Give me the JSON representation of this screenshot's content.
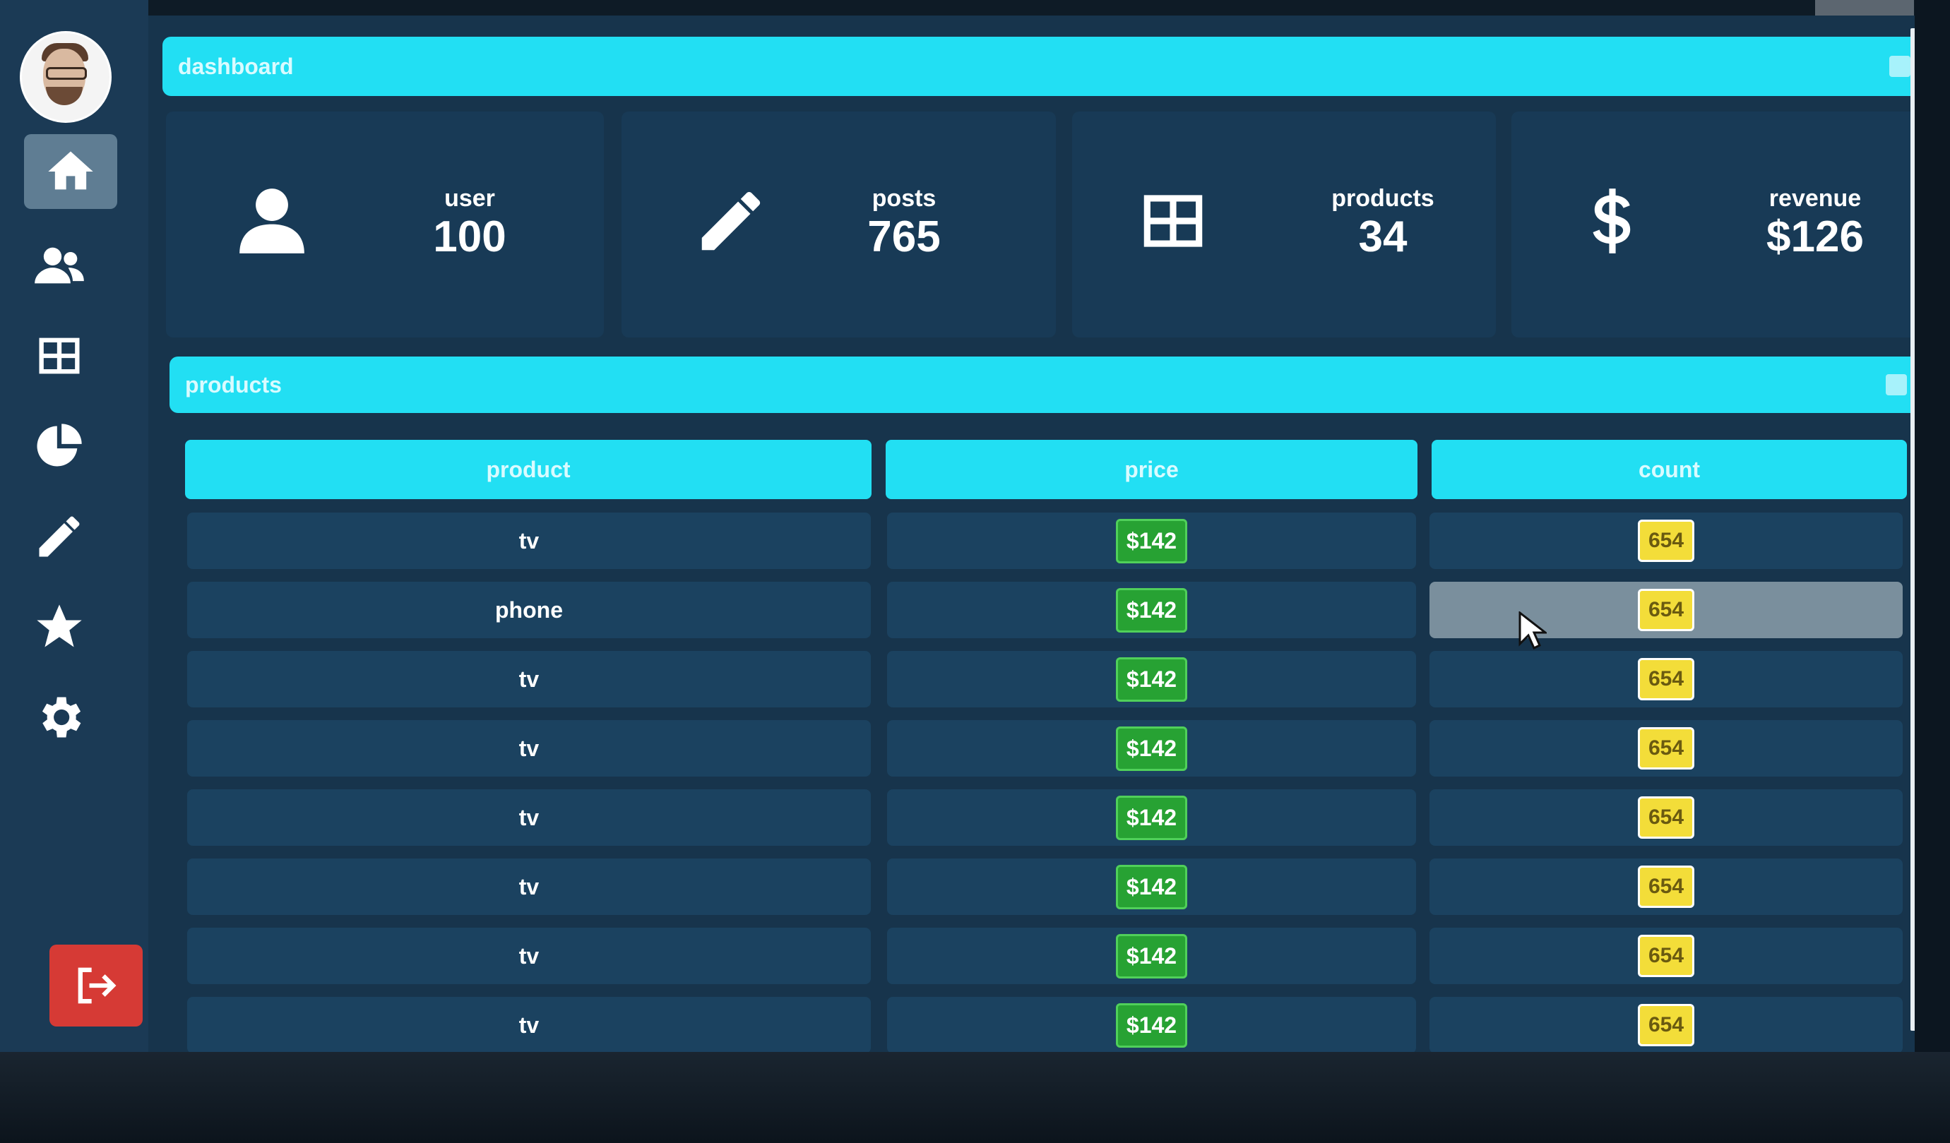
{
  "header": {
    "title": "dashboard"
  },
  "stats": [
    {
      "label": "user",
      "value": "100",
      "icon": "user-icon"
    },
    {
      "label": "posts",
      "value": "765",
      "icon": "pencil-icon"
    },
    {
      "label": "products",
      "value": "34",
      "icon": "grid-icon"
    },
    {
      "label": "revenue",
      "value": "$126",
      "icon": "dollar-icon"
    }
  ],
  "products_section": {
    "title": "products"
  },
  "table": {
    "columns": [
      "product",
      "price",
      "count"
    ],
    "rows": [
      {
        "product": "tv",
        "price": "$142",
        "count": "654"
      },
      {
        "product": "phone",
        "price": "$142",
        "count": "654"
      },
      {
        "product": "tv",
        "price": "$142",
        "count": "654"
      },
      {
        "product": "tv",
        "price": "$142",
        "count": "654"
      },
      {
        "product": "tv",
        "price": "$142",
        "count": "654"
      },
      {
        "product": "tv",
        "price": "$142",
        "count": "654"
      },
      {
        "product": "tv",
        "price": "$142",
        "count": "654"
      },
      {
        "product": "tv",
        "price": "$142",
        "count": "654"
      }
    ]
  },
  "sidebar": {
    "items": [
      "home-icon",
      "users-icon",
      "grid-icon",
      "pie-chart-icon",
      "pencil-icon",
      "star-icon",
      "gear-icon"
    ],
    "logout_icon": "sign-out-icon"
  },
  "colors": {
    "accent": "#22dff3",
    "panel": "#183a56",
    "price": "#27a233",
    "count": "#f3dd39",
    "logout": "#d63a35"
  }
}
